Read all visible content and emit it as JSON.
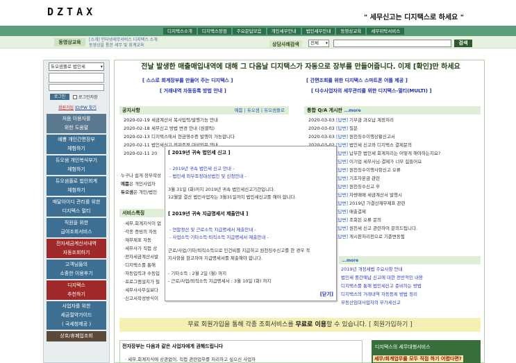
{
  "logo": "DZTAX",
  "slogan": "\" 세무신고는 디지택스로 하세요 \"",
  "topnav": [
    "디지택스소개",
    "디지택스장점",
    "주요문답모음",
    "개인세무안내",
    "법인세무안내",
    "동영상교육",
    "세무위탁서비스"
  ],
  "subbar": {
    "edu_tab": "동영상교육",
    "links_line1": "[소개] 인터넷세무서비스 디지택스 소개",
    "links_line2": "동영상을 통한 세무 및 회계교육",
    "consult_label": "상담사례검색",
    "consult_select": "전체",
    "search_btn": "검색"
  },
  "sidebar": {
    "select": "듀오샘플로 법인세",
    "login_btn": "로그인",
    "save_id": "로그인저장",
    "join": "회원가입",
    "find_id": "ID/PW 찾기",
    "buttons": [
      {
        "l1": "처음 이용자를",
        "l2": "위한 도움말",
        "color": "#5b7a8f"
      },
      {
        "l1": "예쁨 개인간편장부",
        "l2": "체험하기",
        "color": "#3d6f93"
      },
      {
        "l1": "듀오샘 개인복식부기",
        "l2": "체험하기",
        "color": "#3d6f93"
      },
      {
        "l1": "듀오샘플로 법인회계",
        "l2": "체험하기",
        "color": "#3d6f93"
      },
      {
        "l1": "매달아이디 관리를 위한",
        "l2": "디지택스 멀티",
        "color": "#3d6f93"
      },
      {
        "l1": "직원을 위한",
        "l2": "급여조회서비스",
        "color": "#3d6f93"
      },
      {
        "l1": "전자세금계산서내역",
        "l2": "자동조회하기",
        "color": "#a02a2a"
      },
      {
        "l1": "고객님들의",
        "l2": "소중한 이용후기",
        "color": "#3d6f93"
      },
      {
        "l1": "디지택스",
        "l2": "추천하기",
        "color": "#a02a2a"
      },
      {
        "l1": "사업자를 위한",
        "l2": "세금절약가이드",
        "l3": "( 국세청제공 )",
        "color": "#3d6f93"
      },
      {
        "l1": "상호/휴폐업조회",
        "color": "#5b4a3a"
      }
    ]
  },
  "headline": "전날 발생한 매출매입내역에 대해 그 다음날 디지택스가 자동으로 장부를 만들어줍니다. 이제 [확인]만 하세요",
  "promo_links": [
    "[ 스스로 회계장부를 만들어 주는 디지택스 ]",
    "[ 간편조회를 위한 디지택스 스마트폰 어플 제공 ]",
    "[ 거래내역 자동등록 방법 안내 ]",
    "[ 다수사업자의 세무관리를 위한 디지택스-멀티(MULTI) ]"
  ],
  "notice": {
    "title": "공지사항",
    "tabs": "예쁨 | 듀오샘 | 듀오샘플로",
    "rows": [
      {
        "date": "2020-02-19",
        "text": "세금계산서 복사입력/발행기능 안내"
      },
      {
        "date": "2020-02-18",
        "text": "세무신고 방법 변경 안내 (원클릭)"
      },
      {
        "date": "2020-02-13",
        "text": "디지택스에서 현금영수증 발행이 가능합니다"
      },
      {
        "date": "2020-02-11",
        "text": "법인세신고 전자조정 대상업무 안내"
      },
      {
        "date": "2020-02-11",
        "text": "20"
      }
    ]
  },
  "mid_text": {
    "l1": "누구나 쉽게 장부작성",
    "l2_bold": "예쁨",
    "l2": "은 개인사업자",
    "l3_bold": "듀오샘",
    "l3": "은 개인/법인"
  },
  "service": {
    "title": "서비스특징",
    "rows": [
      "세무,회계지식이 없",
      "각종 증빙의 자동",
      "재무제표 자동",
      "세무사가 직접 상",
      "전자세금계산서발",
      "디지택스를 통해",
      "자동입력과 수동입",
      "프로그램설치가 필",
      "세무사사무실보다",
      "신고서작성방식이"
    ]
  },
  "qna": {
    "title": "통합 Q/A 게시판",
    "more": "...more",
    "rows": [
      {
        "date": "2020-03-03",
        "tag": "[답변]",
        "text": "기부금 과오납 계정처리"
      },
      {
        "date": "2020-03-03",
        "tag": "[답변]",
        "text": "질문"
      },
      {
        "date": "2020-03-03",
        "tag": "[답변]",
        "text": "원천징수이행상황신고서"
      },
      {
        "date": "2020-03-02",
        "tag": "[답변]",
        "text": "법인세 신고와 디지택스 결제문의"
      },
      {
        "date": "",
        "tag": "[답변]",
        "text": "납부한 법인세 회계처리는 어떻게 해야하는지요?"
      },
      {
        "date": "",
        "tag": "[답변]",
        "text": "이기업 세무사님-결제가 너무 힘들어요"
      },
      {
        "date": "",
        "tag": "[답변]",
        "text": "원천징수이행사항신고 오류"
      },
      {
        "date": "",
        "tag": "[답변]",
        "text": "기초자본금 관련"
      },
      {
        "date": "",
        "tag": "[답변]",
        "text": "원천징수신고 후"
      },
      {
        "date": "",
        "tag": "[답변]",
        "text": "차량매매 세금계산서 발행시"
      },
      {
        "date": "",
        "tag": "[답변]",
        "text": "2019년 가결산재무제표 관련"
      },
      {
        "date": "",
        "tag": "[답변]",
        "text": "매출결제"
      },
      {
        "date": "",
        "tag": "[답변]",
        "text": "조회된 오류 문의"
      },
      {
        "date": "",
        "tag": "[답변]",
        "text": "원천세 신고 관련하여 문의드립니다."
      },
      {
        "date": "",
        "tag": "[답변]",
        "text": "게시판처리전으로 기준변동됨"
      }
    ]
  },
  "tax_guide": {
    "more": "...more",
    "rows": [
      "2019년 개정세법 주요사항 안내",
      "법인세 중간예납 신고에 대한 전반적인 내용",
      "디지택스를 통해 법인세신고 준비하는 방법",
      "디지택스의 거래내역 자동등록 방법 정리",
      "부동산임대사업자의 부가세신고"
    ]
  },
  "popup": {
    "title1": "[ 2019년 귀속 법인세 신고 ]",
    "link1": "- 2019년 귀속 법인세 신고 안내 -",
    "link2": "- 법인세 외부조정대상법인 및 신청안내 -",
    "text1a": "3월 31일 (화)까지 2019년 귀속 법인세신고기간입니다.",
    "text1b": "12월말 결산 법인사업자는 3월31일까지 법인세신고를 해야 합니다.",
    "title2": "[ 2019년 귀속 지급명세서 제출안내 ]",
    "link3": "- 연말정산 및 근로소득 지급명세서 제출안내 -",
    "link4": "- 사업소득·기타소득·퇴직소득 지급명세서 제출안내 -",
    "text2a": "근로/사업/기타/퇴직소득으로 인건비를 지급하고 원천징수신고를 한 경우 꼭",
    "text2b": "지사항을 참고하여 지급명세서를 제출해야 합니다.",
    "text3a": "- 기타소득 : 2월 2일 (월) 까지",
    "text3b": "- 근로/사업/퇴직소득 지급명세서 : 3월 10일 (화) 까지",
    "close": "[닫기]"
  },
  "free_bar": {
    "pre": "무료 회원가입을 통해 각종 조회서비스를",
    "bold": "무료로 이용",
    "post": "할 수 있습니다.",
    "link": "[ 회원가입하기 ]"
  },
  "bottom": {
    "head": "전자장부는 다음과 같은 사업자에게 권해드립니다",
    "line": "· 세무,회계지식에 상관없이, 직접 관련업무를 처리하고 싶으신 사업자"
  },
  "side_ad": {
    "title": "디지택스의 세무대행서비스",
    "sub": "세무/회계업무를 모두 직접 하기 어렵다면?"
  }
}
